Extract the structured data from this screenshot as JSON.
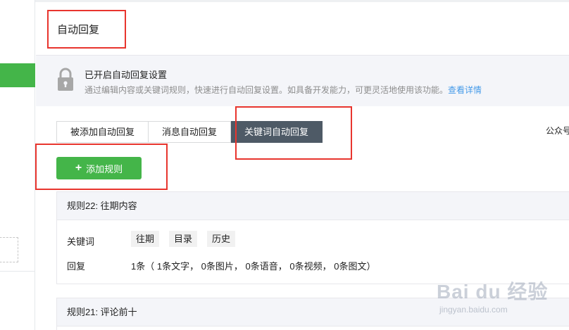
{
  "header": {
    "title": "自动回复"
  },
  "notice": {
    "title": "已开启自动回复设置",
    "description": "通过编辑内容或关键词规则，快速进行自动回复设置。如具备开发能力，可更灵活地使用该功能。",
    "link": "查看详情",
    "icon": "lock-icon"
  },
  "tabs": [
    {
      "label": "被添加自动回复",
      "active": false
    },
    {
      "label": "消息自动回复",
      "active": false
    },
    {
      "label": "关键词自动回复",
      "active": true
    }
  ],
  "right_text": "公众号",
  "add_button": {
    "label": "添加规则",
    "icon": "plus-icon"
  },
  "rules": [
    {
      "title": "规则22: 往期内容",
      "keyword_label": "关键词",
      "keywords": [
        "往期",
        "目录",
        "历史"
      ],
      "reply_label": "回复",
      "reply_summary": "1条（ 1条文字， 0条图片， 0条语音， 0条视频， 0条图文）"
    },
    {
      "title": "规则21: 评论前十"
    }
  ],
  "watermark": {
    "main": "Bai du 经验",
    "sub": "jingyan.baidu.com"
  },
  "colors": {
    "accent_green": "#44b549",
    "active_tab": "#4e5a66",
    "link_blue": "#459ae9",
    "annotation_red": "#e8352e"
  }
}
